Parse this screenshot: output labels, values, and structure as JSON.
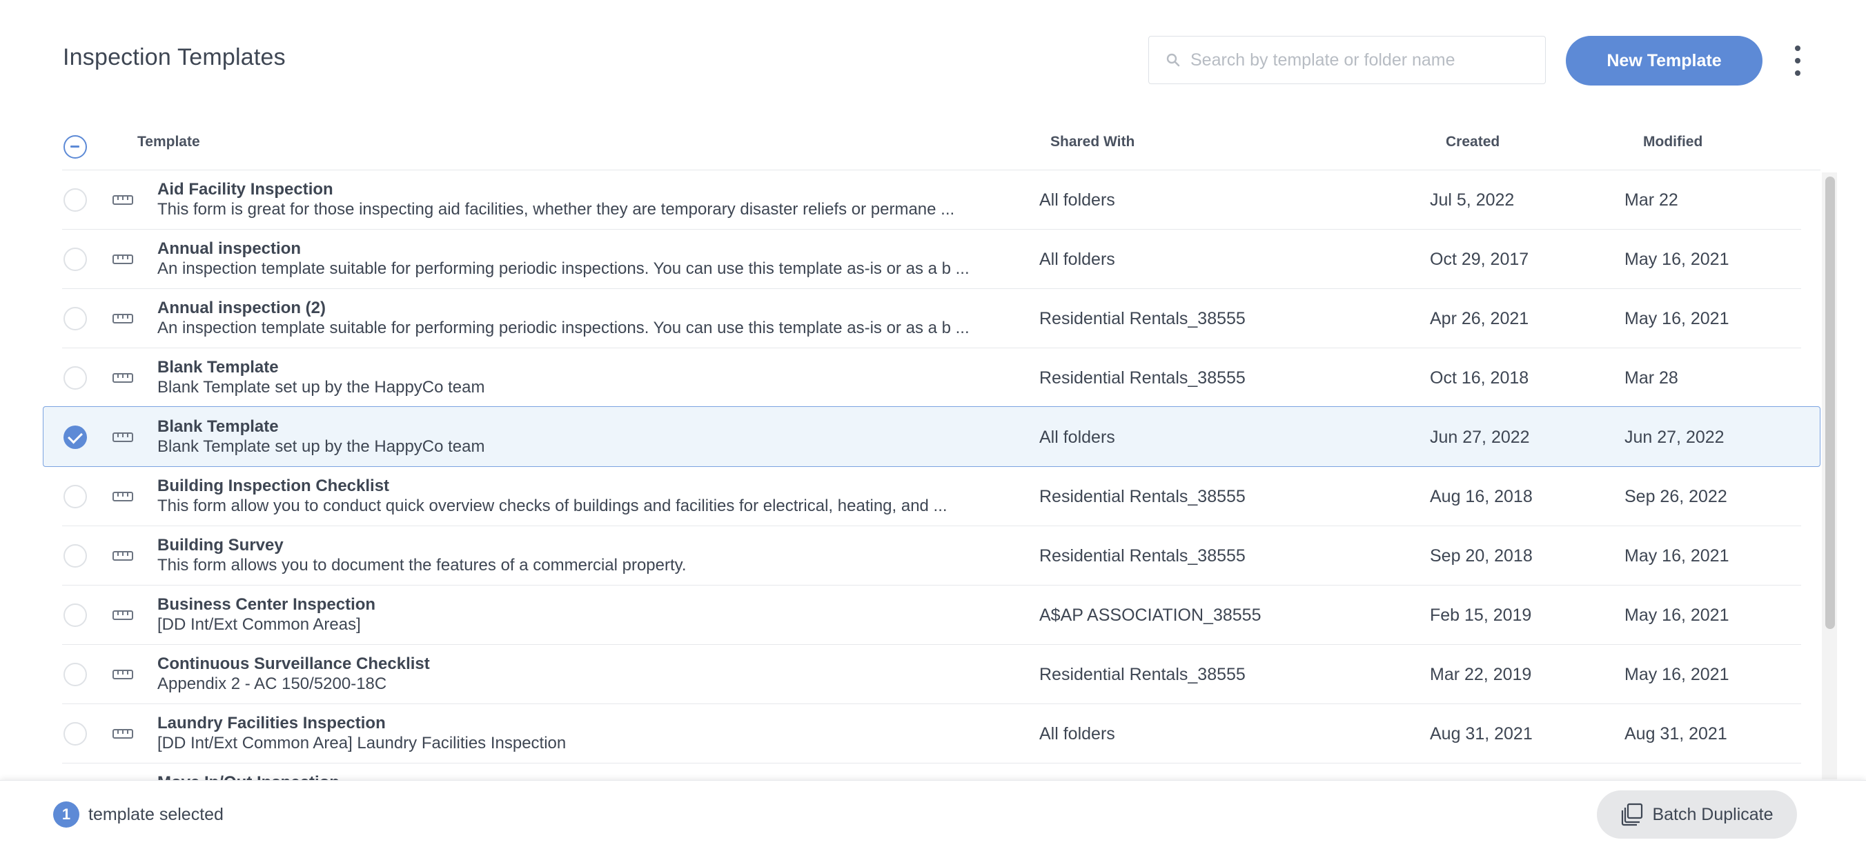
{
  "page": {
    "title": "Inspection Templates"
  },
  "search": {
    "placeholder": "Search by template or folder name",
    "value": ""
  },
  "actions": {
    "new_template_label": "New Template"
  },
  "table": {
    "columns": {
      "template": "Template",
      "shared_with": "Shared With",
      "created": "Created",
      "modified": "Modified"
    },
    "rows": [
      {
        "name": "Aid Facility Inspection",
        "description": "This form is great for those inspecting aid facilities, whether they are temporary disaster reliefs or permane ...",
        "shared_with": "All folders",
        "created": "Jul 5, 2022",
        "modified": "Mar 22",
        "selected": false
      },
      {
        "name": "Annual inspection",
        "description": "An inspection template suitable for performing periodic inspections. You can use this template as-is or as a b ...",
        "shared_with": "All folders",
        "created": "Oct 29, 2017",
        "modified": "May 16, 2021",
        "selected": false
      },
      {
        "name": "Annual inspection (2)",
        "description": "An inspection template suitable for performing periodic inspections. You can use this template as-is or as a b ...",
        "shared_with": "Residential Rentals_38555",
        "created": "Apr 26, 2021",
        "modified": "May 16, 2021",
        "selected": false
      },
      {
        "name": "Blank Template",
        "description": "Blank Template set up by the HappyCo team",
        "shared_with": "Residential Rentals_38555",
        "created": "Oct 16, 2018",
        "modified": "Mar 28",
        "selected": false
      },
      {
        "name": "Blank Template",
        "description": "Blank Template set up by the HappyCo team",
        "shared_with": "All folders",
        "created": "Jun 27, 2022",
        "modified": "Jun 27, 2022",
        "selected": true
      },
      {
        "name": "Building Inspection Checklist",
        "description": "This form allow you to conduct quick overview checks of buildings and facilities for electrical, heating, and ...",
        "shared_with": "Residential Rentals_38555",
        "created": "Aug 16, 2018",
        "modified": "Sep 26, 2022",
        "selected": false
      },
      {
        "name": "Building Survey",
        "description": "This form allows you to document the features of a commercial property.",
        "shared_with": "Residential Rentals_38555",
        "created": "Sep 20, 2018",
        "modified": "May 16, 2021",
        "selected": false
      },
      {
        "name": "Business Center Inspection",
        "description": "[DD Int/Ext Common Areas]",
        "shared_with": "A$AP ASSOCIATION_38555",
        "created": "Feb 15, 2019",
        "modified": "May 16, 2021",
        "selected": false
      },
      {
        "name": "Continuous Surveillance Checklist",
        "description": "Appendix 2 - AC 150/5200-18C",
        "shared_with": "Residential Rentals_38555",
        "created": "Mar 22, 2019",
        "modified": "May 16, 2021",
        "selected": false
      },
      {
        "name": "Laundry Facilities Inspection",
        "description": "[DD Int/Ext Common Area] Laundry Facilities Inspection",
        "shared_with": "All folders",
        "created": "Aug 31, 2021",
        "modified": "Aug 31, 2021",
        "selected": false
      },
      {
        "name": "Move In/Out Inspection",
        "description": "",
        "shared_with": "",
        "created": "",
        "modified": "",
        "selected": false
      }
    ]
  },
  "footer": {
    "selected_count": "1",
    "selected_label": "template selected",
    "batch_duplicate_label": "Batch Duplicate"
  },
  "colors": {
    "accent": "#5d8ad6",
    "selected_row_bg": "#eef5fb",
    "selected_row_border": "#7ba3e0",
    "text": "#3e4653"
  },
  "icons": {
    "search": "search-icon",
    "template": "ruler-icon",
    "more": "kebab-menu-icon",
    "duplicate": "duplicate-icon"
  }
}
